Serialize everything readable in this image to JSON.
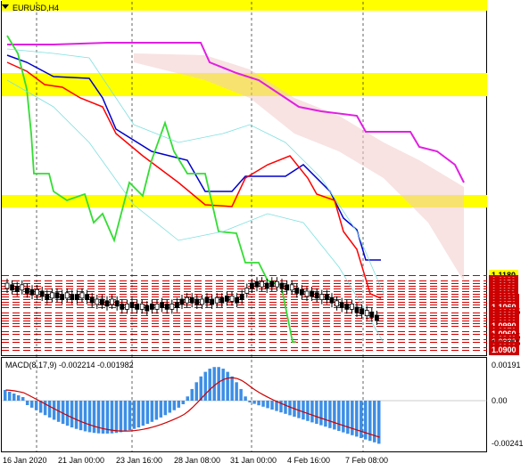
{
  "chart": {
    "symbol_title": "EURUSD,H4",
    "macd_title": "MACD(8,17,9) -0.002214 -0.001982"
  },
  "price_axis": {
    "labels": [
      {
        "text": "1.1180",
        "style": "yellow"
      },
      {
        "text": "1.1160",
        "style": "red"
      },
      {
        "text": "1.1150",
        "style": "red"
      },
      {
        "text": "1.1140",
        "style": "red"
      },
      {
        "text": "1.1130",
        "style": "red"
      },
      {
        "text": "1.1120",
        "style": "red"
      },
      {
        "text": "1.1110",
        "style": "red"
      },
      {
        "text": "1.1100",
        "style": "red"
      },
      {
        "text": "1.1090",
        "style": "red"
      },
      {
        "text": "1.1080",
        "style": "red"
      },
      {
        "text": "1.1070",
        "style": "red"
      },
      {
        "text": "1.1060",
        "style": "red"
      },
      {
        "text": "1.10445",
        "style": "plain"
      },
      {
        "text": "1.1040",
        "style": "red"
      },
      {
        "text": "1.1030",
        "style": "red"
      },
      {
        "text": "1.1020",
        "style": "red"
      },
      {
        "text": "1.1010",
        "style": "red"
      },
      {
        "text": "1.1000",
        "style": "red"
      },
      {
        "text": "1.0990",
        "style": "red"
      },
      {
        "text": "1.0970",
        "style": "red"
      },
      {
        "text": "1.0960",
        "style": "red"
      },
      {
        "text": "1.09495",
        "style": "plain"
      },
      {
        "text": "1.0940",
        "style": "red"
      },
      {
        "text": "1.0930",
        "style": "red"
      },
      {
        "text": "1.09255",
        "style": "plain"
      },
      {
        "text": "1.0910",
        "style": "red"
      },
      {
        "text": "1.0900",
        "style": "red"
      }
    ]
  },
  "macd_axis": {
    "labels": [
      "0.00191",
      "0.00",
      "-0.00241"
    ]
  },
  "time_axis": {
    "labels": [
      "16 Jan 2020",
      "21 Jan 00:00",
      "23 Jan 16:00",
      "28 Jan 08:00",
      "31 Jan 00:00",
      "4 Feb 16:00",
      "7 Feb 08:00"
    ]
  },
  "colors": {
    "level_line": "#cc0000",
    "yellow_zone": "#ffff00",
    "macd_hist": "#3c8ee6",
    "macd_signal": "#cc0000",
    "ma_red": "#ff0000",
    "ma_blue": "#0000cc",
    "chikou_green": "#33dd33",
    "senkou_magenta": "#e020e0"
  }
}
